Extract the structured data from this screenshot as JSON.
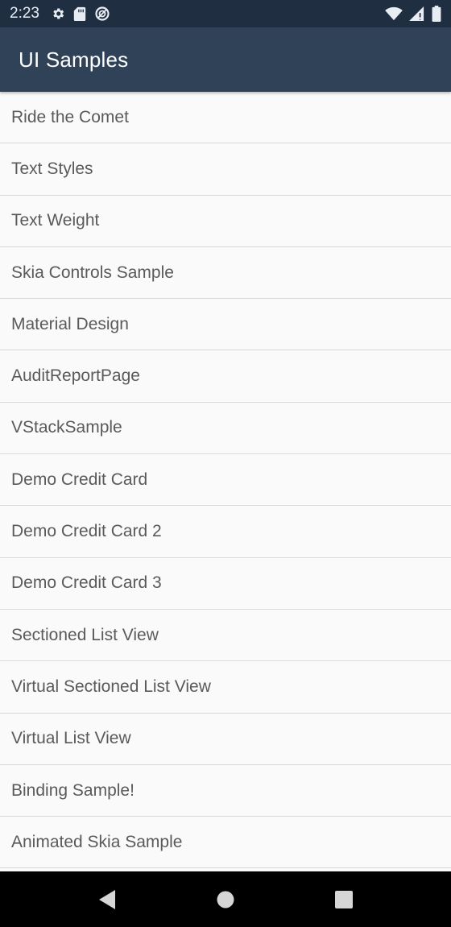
{
  "status_bar": {
    "time": "2:23",
    "left_icons": [
      "gear-icon",
      "sd-card-icon",
      "do-not-disturb-icon"
    ],
    "right_icons": [
      "wifi-icon",
      "cell-signal-icon",
      "battery-icon"
    ]
  },
  "app_bar": {
    "title": "UI Samples"
  },
  "list": {
    "items": [
      {
        "label": "Ride the Comet"
      },
      {
        "label": "Text Styles"
      },
      {
        "label": "Text Weight"
      },
      {
        "label": "Skia Controls Sample"
      },
      {
        "label": "Material Design"
      },
      {
        "label": "AuditReportPage"
      },
      {
        "label": "VStackSample"
      },
      {
        "label": "Demo Credit Card"
      },
      {
        "label": "Demo Credit Card 2"
      },
      {
        "label": "Demo Credit Card 3"
      },
      {
        "label": "Sectioned List View"
      },
      {
        "label": "Virtual Sectioned List View"
      },
      {
        "label": "Virtual List View"
      },
      {
        "label": "Binding Sample!"
      },
      {
        "label": "Animated Skia Sample"
      }
    ]
  },
  "nav_bar": {
    "buttons": [
      "back-icon",
      "home-icon",
      "recents-icon"
    ]
  },
  "colors": {
    "status_bar_bg": "#1f2e40",
    "app_bar_bg": "#2f4258",
    "list_bg": "#fafafa",
    "divider": "#d9d9d9",
    "item_text": "#5a5a5a",
    "nav_bar_bg": "#000000"
  }
}
